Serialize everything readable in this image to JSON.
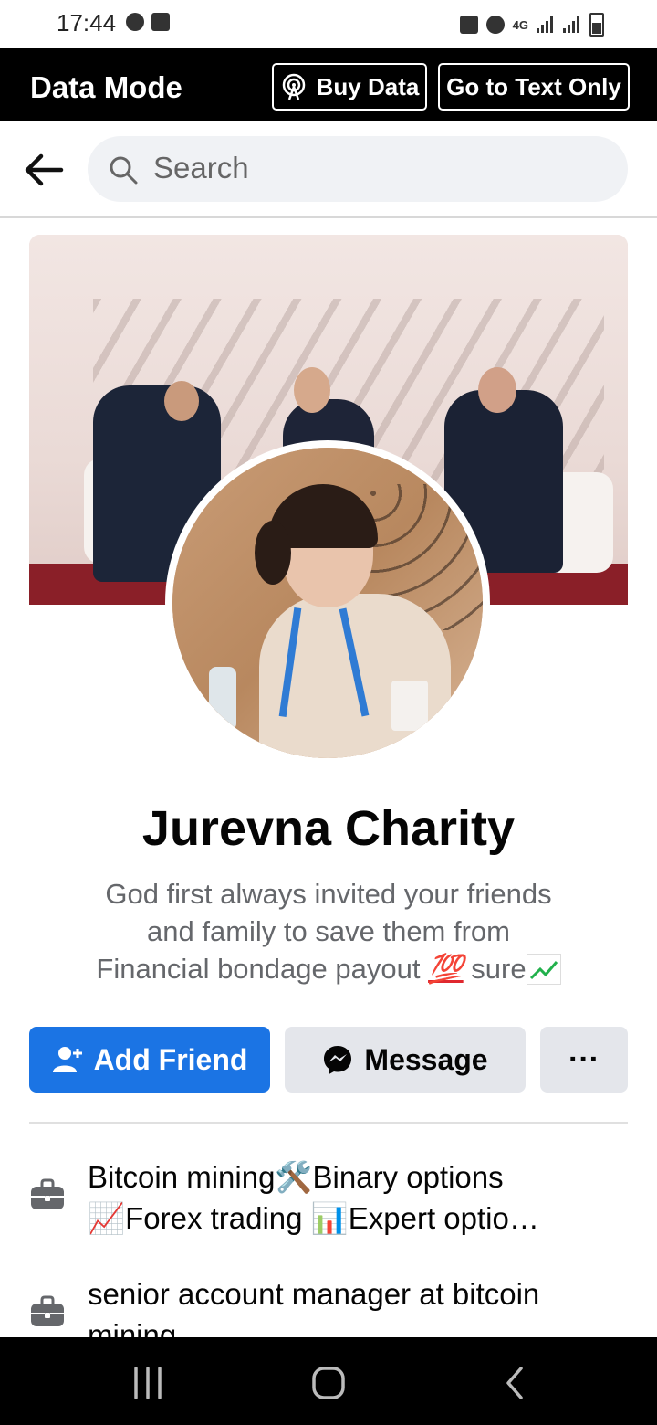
{
  "status_bar": {
    "time": "17:44",
    "left_icons": [
      "messenger-icon",
      "chat-icon"
    ],
    "right_icons": [
      "lock-icon",
      "alarm-icon",
      "4g-icon",
      "signal-icon",
      "signal-icon",
      "battery-icon"
    ],
    "network": "4G"
  },
  "data_bar": {
    "title": "Data Mode",
    "buy_label": "Buy Data",
    "text_only_label": "Go to Text Only"
  },
  "search": {
    "placeholder": "Search"
  },
  "profile": {
    "name": "Jurevna Charity",
    "bio_line1": "God first always invited your friends",
    "bio_line2": "and family to save them from",
    "bio_line3_text": "Financial bondage payout ",
    "bio_emoji_100": "💯",
    "bio_line3_end": " sure"
  },
  "actions": {
    "add_friend_label": "Add Friend",
    "message_label": "Message",
    "more_label": "···"
  },
  "info": {
    "work1_line1": "Bitcoin mining🛠️Binary options",
    "work1_line2": "📈Forex trading 📊Expert optio…",
    "work2_line1": "senior account manager at bitcoin",
    "work2_line2": "mining"
  },
  "colors": {
    "primary": "#1b74e4",
    "secondary_btn": "#e4e6eb",
    "text": "#050505",
    "muted": "#65676b"
  }
}
